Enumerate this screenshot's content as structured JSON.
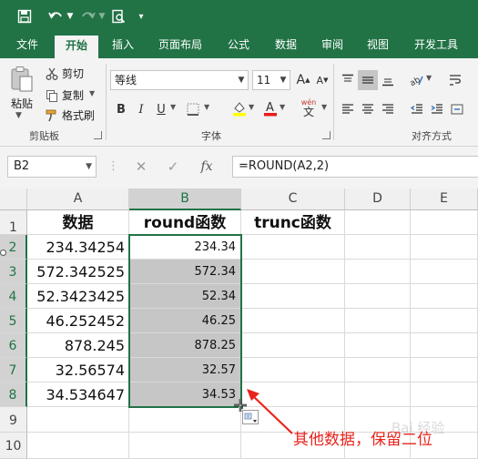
{
  "ribbon_tabs": [
    "文件",
    "开始",
    "插入",
    "页面布局",
    "公式",
    "数据",
    "审阅",
    "视图",
    "开发工具"
  ],
  "clipboard": {
    "paste_label": "粘贴",
    "cut_label": "剪切",
    "copy_label": "复制",
    "format_painter_label": "格式刷",
    "group_label": "剪贴板"
  },
  "font": {
    "font_name": "等线",
    "font_size": "11",
    "font_size_up": "A",
    "font_size_down": "A",
    "bold": "B",
    "italic": "I",
    "underline": "U",
    "phonetic": "wén",
    "phonetic_sub": "文",
    "group_label": "字体"
  },
  "alignment": {
    "group_label": "对齐方式"
  },
  "formula_bar": {
    "name_box": "B2",
    "cancel": "✕",
    "enter": "✓",
    "fx": "fx",
    "formula": "=ROUND(A2,2)"
  },
  "columns": [
    "A",
    "B",
    "C",
    "D",
    "E"
  ],
  "rows": [
    "1",
    "2",
    "3",
    "4",
    "5",
    "6",
    "7",
    "8",
    "9",
    "10"
  ],
  "table": {
    "header_a": "数据",
    "header_b": "round函数",
    "header_c": "trunc函数",
    "data": [
      "234.34254",
      "572.342525",
      "52.3423425",
      "46.252452",
      "878.245",
      "32.56574",
      "34.534647"
    ],
    "round": [
      "234.34",
      "572.34",
      "52.34",
      "46.25",
      "878.25",
      "32.57",
      "34.53"
    ]
  },
  "annotation": "其他数据，保留二位",
  "watermark": "Bai 经验",
  "colors": {
    "excel_green": "#217346",
    "annotation_red": "#e8241c",
    "selection_gray": "#c6c6c6"
  }
}
